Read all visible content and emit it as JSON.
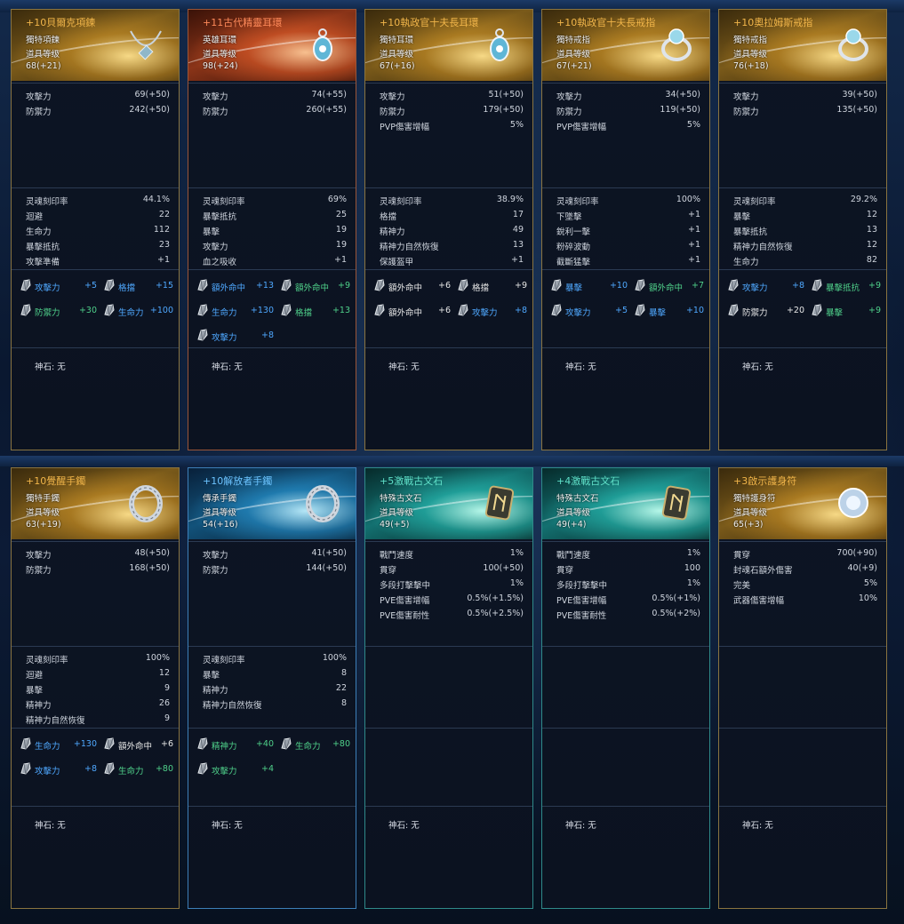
{
  "rows": [
    [
      {
        "theme": "gold",
        "title": "+10貝爾克項鍊",
        "item_type": "獨特項鍊",
        "level_label": "道具等级",
        "level": "68(+21)",
        "icon": "necklace-icon",
        "stats": [
          {
            "k": "攻擊力",
            "v": "69(+50)"
          },
          {
            "k": "防禦力",
            "v": "242(+50)"
          }
        ],
        "soul": [
          {
            "k": "灵魂刻印率",
            "v": "44.1%"
          },
          {
            "k": "迴避",
            "v": "22"
          },
          {
            "k": "生命力",
            "v": "112"
          },
          {
            "k": "暴擊抵抗",
            "v": "23"
          },
          {
            "k": "攻擊準備",
            "v": "+1"
          }
        ],
        "gems": [
          {
            "k": "攻擊力",
            "v": "+5",
            "c": "blue"
          },
          {
            "k": "格擋",
            "v": "+15",
            "c": "blue"
          },
          {
            "k": "防禦力",
            "v": "+30",
            "c": "green"
          },
          {
            "k": "生命力",
            "v": "+100",
            "c": "blue"
          }
        ],
        "godstone": "神石: 无"
      },
      {
        "theme": "red",
        "title": "+11古代精靈耳環",
        "item_type": "英雄耳環",
        "level_label": "道具等级",
        "level": "98(+24)",
        "icon": "earring-icon",
        "stats": [
          {
            "k": "攻擊力",
            "v": "74(+55)"
          },
          {
            "k": "防禦力",
            "v": "260(+55)"
          }
        ],
        "soul": [
          {
            "k": "灵魂刻印率",
            "v": "69%"
          },
          {
            "k": "暴擊抵抗",
            "v": "25"
          },
          {
            "k": "暴擊",
            "v": "19"
          },
          {
            "k": "攻擊力",
            "v": "19"
          },
          {
            "k": "血之吸收",
            "v": "+1"
          }
        ],
        "gems": [
          {
            "k": "額外命中",
            "v": "+13",
            "c": "blue"
          },
          {
            "k": "額外命中",
            "v": "+9",
            "c": "green"
          },
          {
            "k": "生命力",
            "v": "+130",
            "c": "blue"
          },
          {
            "k": "格擋",
            "v": "+13",
            "c": "green"
          },
          {
            "k": "攻擊力",
            "v": "+8",
            "c": "blue"
          }
        ],
        "godstone": "神石: 无"
      },
      {
        "theme": "gold",
        "title": "+10執政官十夫長耳環",
        "item_type": "獨特耳環",
        "level_label": "道具等级",
        "level": "67(+16)",
        "icon": "earring-icon",
        "stats": [
          {
            "k": "攻擊力",
            "v": "51(+50)"
          },
          {
            "k": "防禦力",
            "v": "179(+50)"
          },
          {
            "k": "PVP傷害增幅",
            "v": "5%"
          }
        ],
        "soul": [
          {
            "k": "灵魂刻印率",
            "v": "38.9%"
          },
          {
            "k": "格擋",
            "v": "17"
          },
          {
            "k": "精神力",
            "v": "49"
          },
          {
            "k": "精神力自然恢復",
            "v": "13"
          },
          {
            "k": "保護盔甲",
            "v": "+1"
          }
        ],
        "gems": [
          {
            "k": "額外命中",
            "v": "+6",
            "c": "white"
          },
          {
            "k": "格擋",
            "v": "+9",
            "c": "white"
          },
          {
            "k": "額外命中",
            "v": "+6",
            "c": "white"
          },
          {
            "k": "攻擊力",
            "v": "+8",
            "c": "blue"
          }
        ],
        "godstone": "神石: 无"
      },
      {
        "theme": "gold",
        "title": "+10執政官十夫長戒指",
        "item_type": "獨特戒指",
        "level_label": "道具等级",
        "level": "67(+21)",
        "icon": "ring-icon",
        "stats": [
          {
            "k": "攻擊力",
            "v": "34(+50)"
          },
          {
            "k": "防禦力",
            "v": "119(+50)"
          },
          {
            "k": "PVP傷害增幅",
            "v": "5%"
          }
        ],
        "soul": [
          {
            "k": "灵魂刻印率",
            "v": "100%"
          },
          {
            "k": "下墜擊",
            "v": "+1"
          },
          {
            "k": "銳利一擊",
            "v": "+1"
          },
          {
            "k": "粉碎波動",
            "v": "+1"
          },
          {
            "k": "截斷猛擊",
            "v": "+1"
          }
        ],
        "gems": [
          {
            "k": "暴擊",
            "v": "+10",
            "c": "blue"
          },
          {
            "k": "額外命中",
            "v": "+7",
            "c": "green"
          },
          {
            "k": "攻擊力",
            "v": "+5",
            "c": "blue"
          },
          {
            "k": "暴擊",
            "v": "+10",
            "c": "blue"
          }
        ],
        "godstone": "神石: 无"
      },
      {
        "theme": "gold",
        "title": "+10奧拉姆斯戒指",
        "item_type": "獨特戒指",
        "level_label": "道具等级",
        "level": "76(+18)",
        "icon": "ring-icon",
        "stats": [
          {
            "k": "攻擊力",
            "v": "39(+50)"
          },
          {
            "k": "防禦力",
            "v": "135(+50)"
          }
        ],
        "soul": [
          {
            "k": "灵魂刻印率",
            "v": "29.2%"
          },
          {
            "k": "暴擊",
            "v": "12"
          },
          {
            "k": "暴擊抵抗",
            "v": "13"
          },
          {
            "k": "精神力自然恢復",
            "v": "12"
          },
          {
            "k": "生命力",
            "v": "82"
          }
        ],
        "gems": [
          {
            "k": "攻擊力",
            "v": "+8",
            "c": "blue"
          },
          {
            "k": "暴擊抵抗",
            "v": "+9",
            "c": "green"
          },
          {
            "k": "防禦力",
            "v": "+20",
            "c": "white"
          },
          {
            "k": "暴擊",
            "v": "+9",
            "c": "green"
          }
        ],
        "godstone": "神石: 无"
      }
    ],
    [
      {
        "theme": "gold",
        "title": "+10覺醒手鐲",
        "item_type": "獨特手鐲",
        "level_label": "道具等级",
        "level": "63(+19)",
        "icon": "bracelet-icon",
        "stats": [
          {
            "k": "攻擊力",
            "v": "48(+50)"
          },
          {
            "k": "防禦力",
            "v": "168(+50)"
          }
        ],
        "soul": [
          {
            "k": "灵魂刻印率",
            "v": "100%"
          },
          {
            "k": "迴避",
            "v": "12"
          },
          {
            "k": "暴擊",
            "v": "9"
          },
          {
            "k": "精神力",
            "v": "26"
          },
          {
            "k": "精神力自然恢復",
            "v": "9"
          }
        ],
        "gems": [
          {
            "k": "生命力",
            "v": "+130",
            "c": "blue"
          },
          {
            "k": "額外命中",
            "v": "+6",
            "c": "white"
          },
          {
            "k": "攻擊力",
            "v": "+8",
            "c": "blue"
          },
          {
            "k": "生命力",
            "v": "+80",
            "c": "green"
          }
        ],
        "godstone": "神石: 无"
      },
      {
        "theme": "blue",
        "title": "+10解放者手鐲",
        "item_type": "傳承手鐲",
        "level_label": "道具等级",
        "level": "54(+16)",
        "icon": "bracelet-icon",
        "stats": [
          {
            "k": "攻擊力",
            "v": "41(+50)"
          },
          {
            "k": "防禦力",
            "v": "144(+50)"
          }
        ],
        "soul": [
          {
            "k": "灵魂刻印率",
            "v": "100%"
          },
          {
            "k": "暴擊",
            "v": "8"
          },
          {
            "k": "精神力",
            "v": "22"
          },
          {
            "k": "精神力自然恢復",
            "v": "8"
          }
        ],
        "gems": [
          {
            "k": "精神力",
            "v": "+40",
            "c": "green"
          },
          {
            "k": "生命力",
            "v": "+80",
            "c": "green"
          },
          {
            "k": "攻擊力",
            "v": "+4",
            "c": "green"
          }
        ],
        "godstone": "神石: 无"
      },
      {
        "theme": "cyan",
        "title": "+5激戰古文石",
        "item_type": "特殊古文石",
        "level_label": "道具等级",
        "level": "49(+5)",
        "icon": "rune-stone-icon",
        "stats": [
          {
            "k": "戰鬥速度",
            "v": "1%"
          },
          {
            "k": "貫穿",
            "v": "100(+50)"
          },
          {
            "k": "多段打擊擊中",
            "v": "1%"
          },
          {
            "k": "PVE傷害增幅",
            "v": "0.5%(+1.5%)"
          },
          {
            "k": "PVE傷害耐性",
            "v": "0.5%(+2.5%)"
          }
        ],
        "soul": [],
        "gems": [],
        "godstone": "神石: 无"
      },
      {
        "theme": "cyan",
        "title": "+4激戰古文石",
        "item_type": "特殊古文石",
        "level_label": "道具等级",
        "level": "49(+4)",
        "icon": "rune-stone-icon",
        "stats": [
          {
            "k": "戰鬥速度",
            "v": "1%"
          },
          {
            "k": "貫穿",
            "v": "100"
          },
          {
            "k": "多段打擊擊中",
            "v": "1%"
          },
          {
            "k": "PVE傷害增幅",
            "v": "0.5%(+1%)"
          },
          {
            "k": "PVE傷害耐性",
            "v": "0.5%(+2%)"
          }
        ],
        "soul": [],
        "gems": [],
        "godstone": "神石: 无"
      },
      {
        "theme": "gold",
        "title": "+3啟示護身符",
        "item_type": "獨特護身符",
        "level_label": "道具等级",
        "level": "65(+3)",
        "icon": "amulet-icon",
        "stats": [
          {
            "k": "貫穿",
            "v": "700(+90)"
          },
          {
            "k": "封魂石額外傷害",
            "v": "40(+9)"
          },
          {
            "k": "完美",
            "v": "5%"
          },
          {
            "k": "武器傷害增幅",
            "v": "10%"
          }
        ],
        "soul": [],
        "gems": [],
        "godstone": "神石: 无"
      }
    ]
  ]
}
